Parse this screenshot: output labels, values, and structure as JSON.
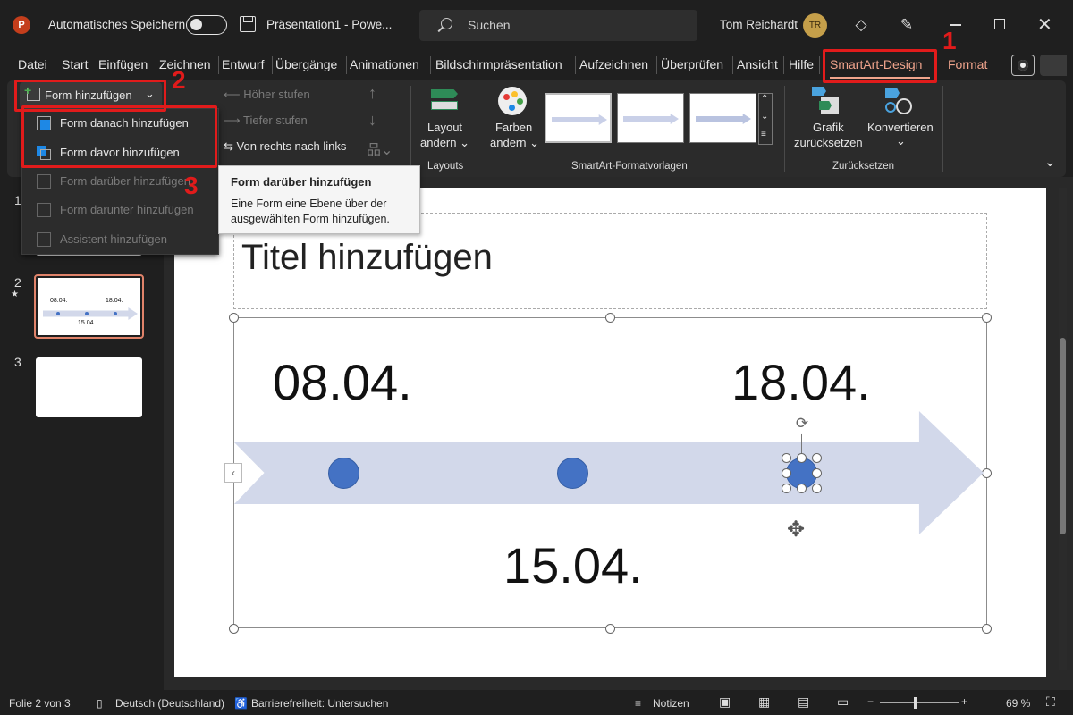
{
  "titlebar": {
    "app_logo": "P",
    "autosave_label": "Automatisches Speichern",
    "doc_title": "Präsentation1  -  Powe...",
    "search_placeholder": "Suchen",
    "user_name": "Tom Reichardt",
    "user_initials": "TR"
  },
  "tabs": [
    "Datei",
    "Start",
    "Einfügen",
    "Zeichnen",
    "Entwurf",
    "Übergänge",
    "Animationen",
    "Bildschirmpräsentation",
    "Aufzeichnen",
    "Überprüfen",
    "Ansicht",
    "Hilfe"
  ],
  "tab_smartart": "SmartArt-Design",
  "tab_format": "Format",
  "ribbon": {
    "add_shape": "Form hinzufügen",
    "promote": "Höher stufen",
    "demote": "Tiefer stufen",
    "right_to_left": "Von rechts nach links",
    "layout_line1": "Layout",
    "layout_line2": "ändern",
    "layouts_group": "Layouts",
    "colors_line1": "Farben",
    "colors_line2": "ändern",
    "styles_group": "SmartArt-Formatvorlagen",
    "reset_line1": "Grafik",
    "reset_line2": "zurücksetzen",
    "convert": "Konvertieren",
    "reset_group": "Zurücksetzen"
  },
  "dropdown": {
    "items": [
      {
        "label": "Form danach hinzufügen",
        "enabled": true
      },
      {
        "label": "Form davor hinzufügen",
        "enabled": true
      },
      {
        "label": "Form darüber hinzufügen",
        "enabled": false
      },
      {
        "label": "Form darunter hinzufügen",
        "enabled": false
      },
      {
        "label": "Assistent hinzufügen",
        "enabled": false
      }
    ]
  },
  "tooltip": {
    "title": "Form darüber hinzufügen",
    "body": "Eine Form eine Ebene über der ausgewählten Form hinzufügen."
  },
  "annotations": {
    "n1": "1",
    "n2": "2",
    "n3": "3"
  },
  "slides": {
    "numbers": [
      "1",
      "2",
      "3"
    ],
    "slide2_star": "★",
    "thumb_date1": "08.04.",
    "thumb_date2": "18.04.",
    "thumb_date3": "15.04."
  },
  "slide": {
    "title_placeholder": "Titel hinzufügen",
    "date1": "08.04.",
    "date2": "18.04.",
    "date3": "15.04."
  },
  "statusbar": {
    "slide_info": "Folie 2 von 3",
    "language": "Deutsch (Deutschland)",
    "accessibility": "Barrierefreiheit: Untersuchen",
    "notes": "Notizen",
    "zoom": "69 %"
  },
  "colors": {
    "accent": "#f0a48c",
    "annotation": "#e11b1b",
    "dot": "#4472c4",
    "arrow": "#d2d8ea"
  }
}
